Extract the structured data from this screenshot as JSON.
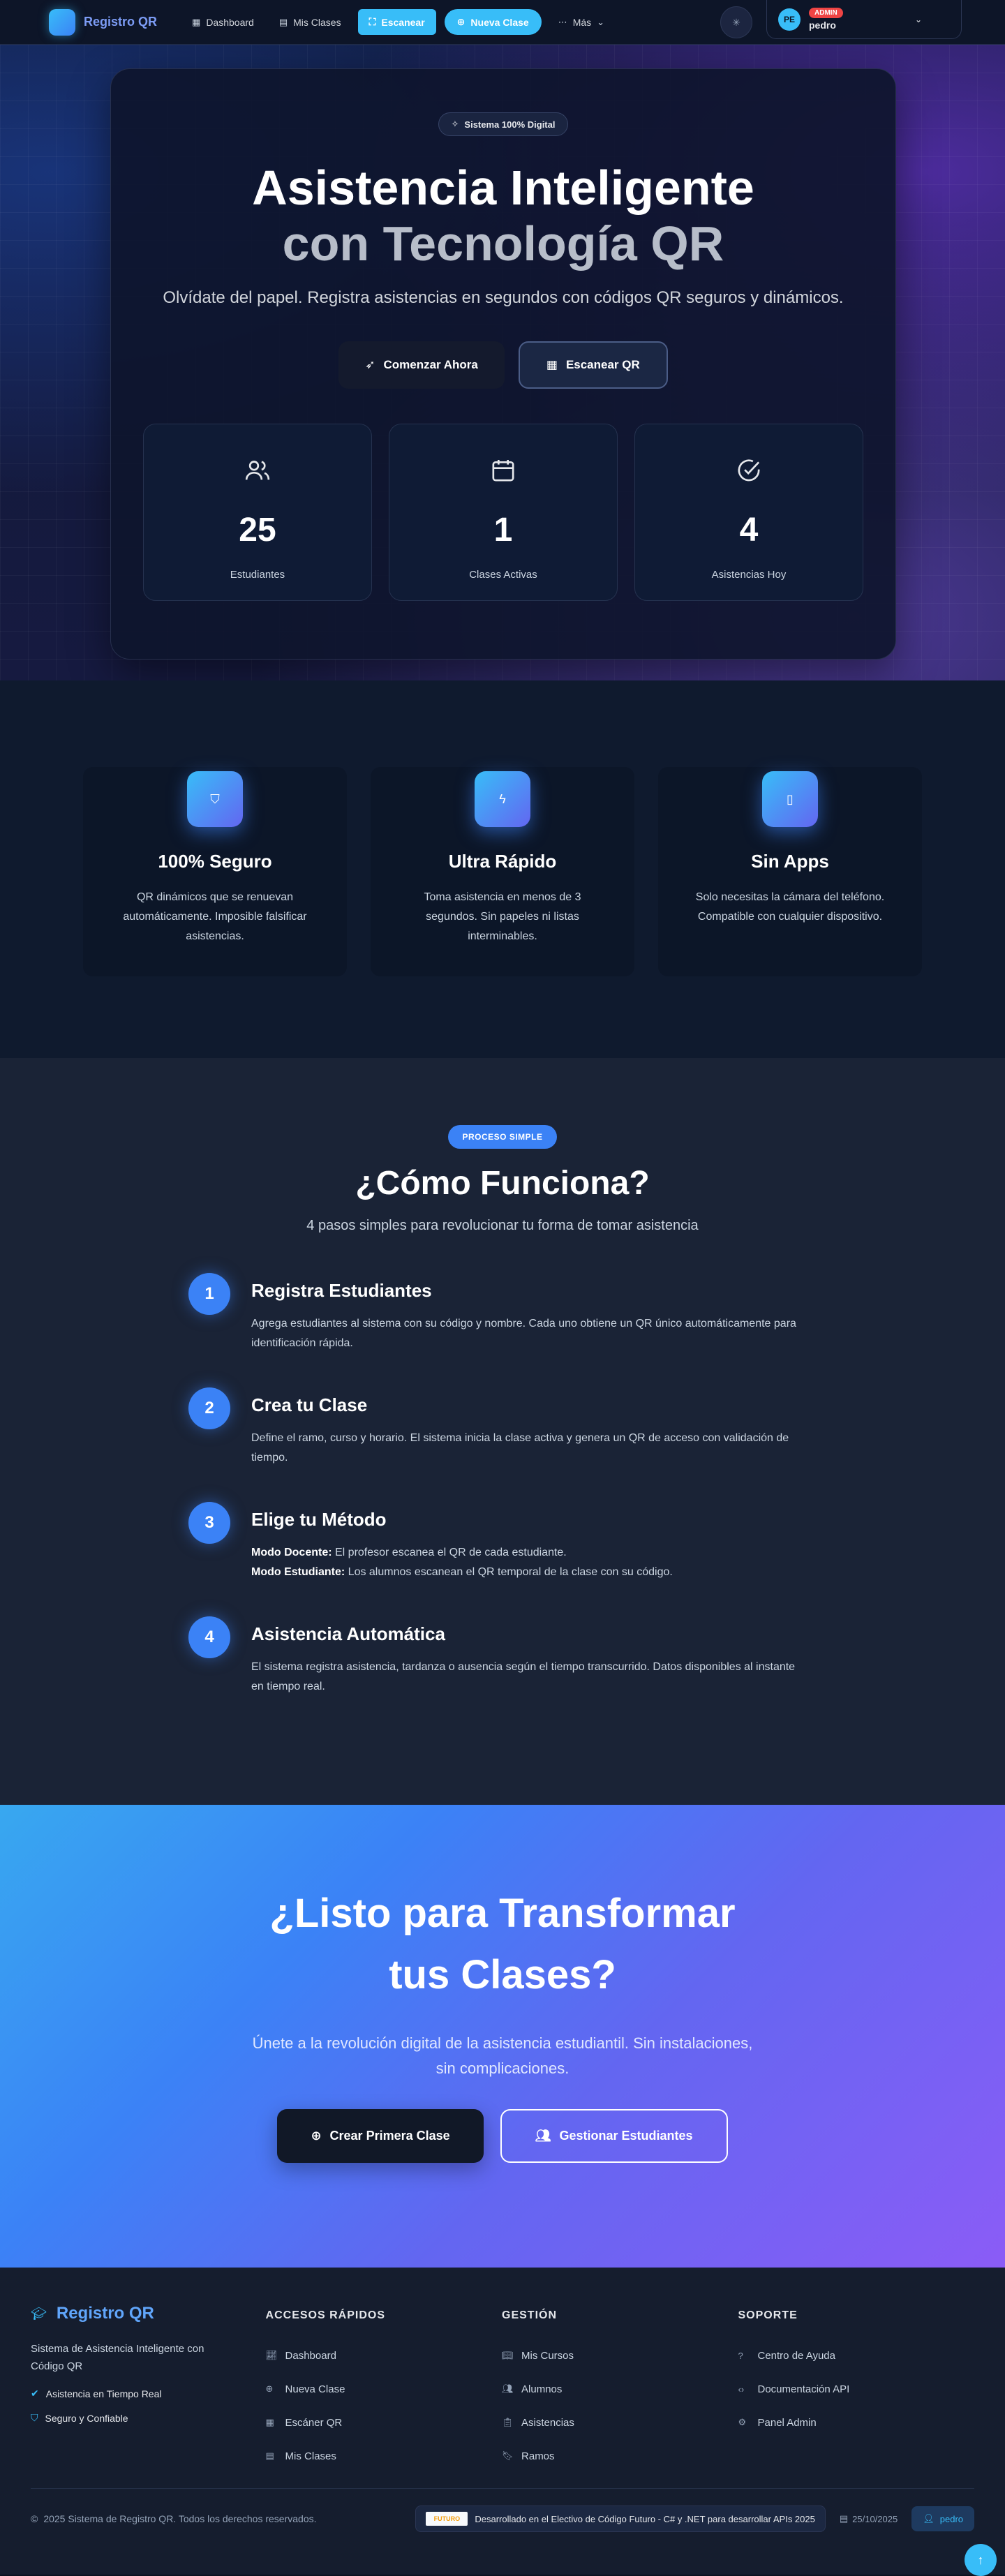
{
  "navbar": {
    "brand": "Registro QR",
    "items": [
      {
        "label": "Dashboard",
        "icon": "dashboard-icon"
      },
      {
        "label": "Mis Clases",
        "icon": "calendar-icon"
      }
    ],
    "scan_label": "Escanear",
    "new_class_label": "Nueva Clase",
    "more_label": "Más",
    "user": {
      "initials": "PE",
      "badge": "ADMIN",
      "name": "pedro"
    }
  },
  "hero": {
    "pill": "Sistema 100% Digital",
    "title_line1": "Asistencia Inteligente",
    "title_line2": "con Tecnología QR",
    "subtitle": "Olvídate del papel. Registra asistencias en segundos con códigos QR seguros y dinámicos.",
    "cta_start": "Comenzar Ahora",
    "cta_scan": "Escanear QR",
    "stats": [
      {
        "value": "25",
        "label": "Estudiantes",
        "icon": "users-icon"
      },
      {
        "value": "1",
        "label": "Clases Activas",
        "icon": "calendar-icon"
      },
      {
        "value": "4",
        "label": "Asistencias Hoy",
        "icon": "check-circle-icon"
      }
    ]
  },
  "features": [
    {
      "title": "100% Seguro",
      "desc": "QR dinámicos que se renuevan automáticamente. Imposible falsificar asistencias.",
      "icon": "shield-icon"
    },
    {
      "title": "Ultra Rápido",
      "desc": "Toma asistencia en menos de 3 segundos. Sin papeles ni listas interminables.",
      "icon": "bolt-icon"
    },
    {
      "title": "Sin Apps",
      "desc": "Solo necesitas la cámara del teléfono. Compatible con cualquier dispositivo.",
      "icon": "phone-icon"
    }
  ],
  "how": {
    "pill": "PROCESO SIMPLE",
    "title": "¿Cómo Funciona?",
    "subtitle": "4 pasos simples para revolucionar tu forma de tomar asistencia",
    "steps": [
      {
        "num": "1",
        "title": "Registra Estudiantes",
        "desc": "Agrega estudiantes al sistema con su código y nombre. Cada uno obtiene un QR único automáticamente para identificación rápida."
      },
      {
        "num": "2",
        "title": "Crea tu Clase",
        "desc": "Define el ramo, curso y horario. El sistema inicia la clase activa y genera un QR de acceso con validación de tiempo."
      },
      {
        "num": "3",
        "title": "Elige tu Método",
        "mode1_label": "Modo Docente:",
        "mode1_text": " El profesor escanea el QR de cada estudiante.",
        "mode2_label": "Modo Estudiante:",
        "mode2_text": " Los alumnos escanean el QR temporal de la clase con su código."
      },
      {
        "num": "4",
        "title": "Asistencia Automática",
        "desc": "El sistema registra asistencia, tardanza o ausencia según el tiempo transcurrido. Datos disponibles al instante en tiempo real."
      }
    ]
  },
  "cta": {
    "title_line1": "¿Listo para Transformar",
    "title_line2": "tus Clases?",
    "sub_line1": "Únete a la revolución digital de la asistencia estudiantil. Sin instalaciones,",
    "sub_line2": "sin complicaciones.",
    "primary": "Crear Primera Clase",
    "secondary": "Gestionar Estudiantes"
  },
  "footer": {
    "brand": "Registro QR",
    "desc": "Sistema de Asistencia Inteligente con Código QR",
    "checks": [
      "Asistencia en Tiempo Real",
      "Seguro y Confiable"
    ],
    "cols": [
      {
        "head": "ACCESOS RÁPIDOS",
        "links": [
          {
            "label": "Dashboard",
            "icon": "chart-icon"
          },
          {
            "label": "Nueva Clase",
            "icon": "plus-circle-icon"
          },
          {
            "label": "Escáner QR",
            "icon": "qr-icon"
          },
          {
            "label": "Mis Clases",
            "icon": "calendar-icon"
          }
        ]
      },
      {
        "head": "GESTIÓN",
        "links": [
          {
            "label": "Mis Cursos",
            "icon": "book-icon"
          },
          {
            "label": "Alumnos",
            "icon": "users-icon"
          },
          {
            "label": "Asistencias",
            "icon": "clipboard-icon"
          },
          {
            "label": "Ramos",
            "icon": "bookmark-icon"
          }
        ]
      },
      {
        "head": "SOPORTE",
        "links": [
          {
            "label": "Centro de Ayuda",
            "icon": "help-icon"
          },
          {
            "label": "Documentación API",
            "icon": "code-icon"
          },
          {
            "label": "Panel Admin",
            "icon": "gear-icon"
          }
        ]
      }
    ],
    "copyright": "2025 Sistema de Registro QR. Todos los derechos reservados.",
    "elective_logo": "FUTURO",
    "elective": "Desarrollado en el Electivo de Código Futuro - C# y .NET para desarrollar APIs 2025",
    "date": "25/10/2025",
    "user": "pedro"
  }
}
